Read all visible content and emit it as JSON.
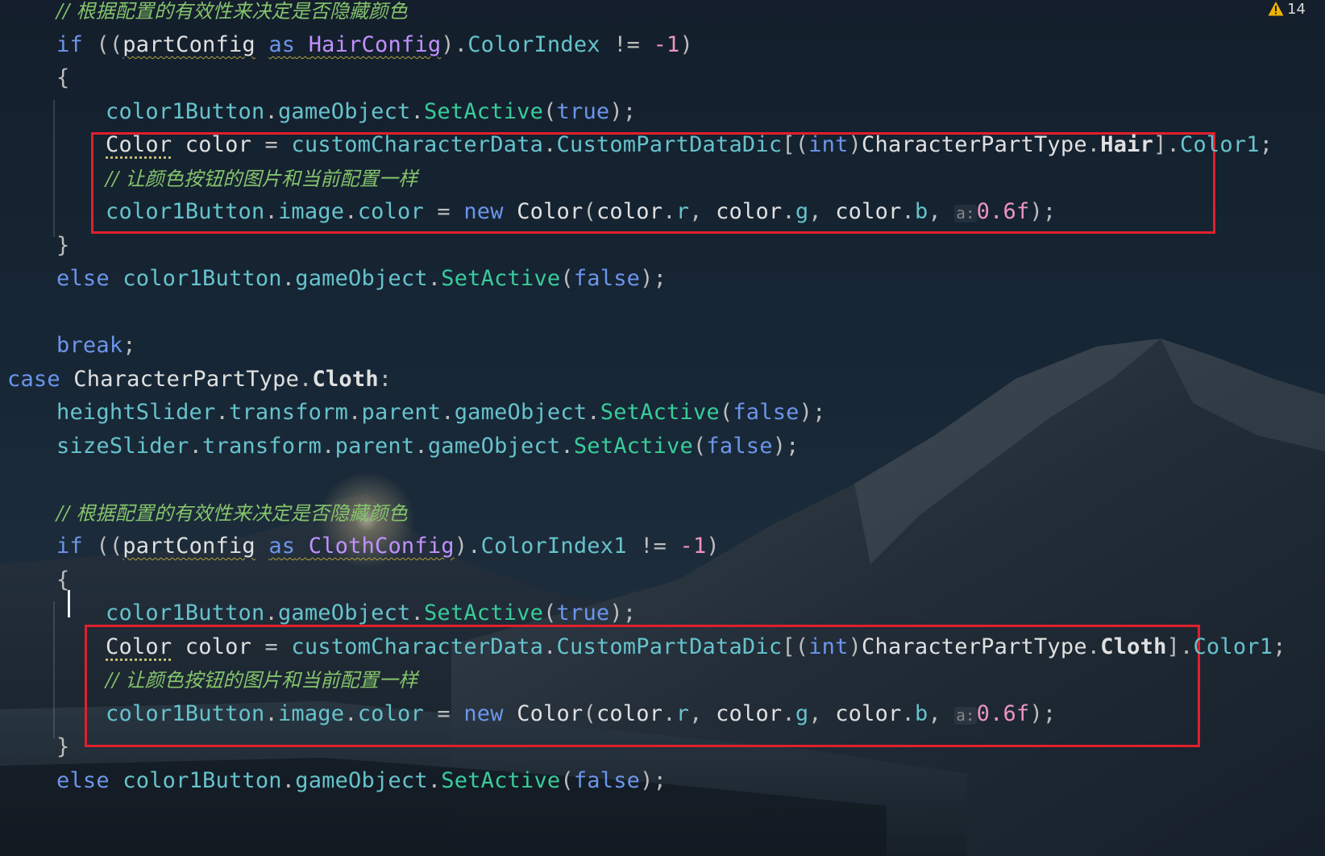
{
  "editor": {
    "problems": {
      "warning_count": "14",
      "icon": "warning-triangle-icon",
      "color": "#f0b400"
    },
    "colors": {
      "keyword": "#6c95eb",
      "field": "#66c3cc",
      "method": "#39cc9b",
      "class": "#c191ff",
      "number": "#ed94c0",
      "comment": "#85c46c",
      "highlight_box": "#e0202c"
    },
    "lines": [
      [
        {
          "t": "// 根据配置的有效性来决定是否隐藏颜色",
          "c": "cmt"
        }
      ],
      [
        {
          "t": "if",
          "c": "kw"
        },
        {
          "t": " ((",
          "c": "pun"
        },
        {
          "t": "partConfig",
          "c": "typ squig"
        },
        {
          "t": " ",
          "c": "pun"
        },
        {
          "t": "as",
          "c": "kw squig"
        },
        {
          "t": " ",
          "c": "pun squig"
        },
        {
          "t": "HairConfig",
          "c": "cls squig"
        },
        {
          "t": ").",
          "c": "pun"
        },
        {
          "t": "ColorIndex",
          "c": "id"
        },
        {
          "t": " != ",
          "c": "pun"
        },
        {
          "t": "-1",
          "c": "num"
        },
        {
          "t": ")",
          "c": "pun"
        }
      ],
      [
        {
          "t": "{",
          "c": "pun"
        }
      ],
      [
        {
          "t": "color1Button",
          "c": "id"
        },
        {
          "t": ".",
          "c": "pun"
        },
        {
          "t": "gameObject",
          "c": "id"
        },
        {
          "t": ".",
          "c": "pun"
        },
        {
          "t": "SetActive",
          "c": "meth"
        },
        {
          "t": "(",
          "c": "pun"
        },
        {
          "t": "true",
          "c": "kw"
        },
        {
          "t": ");",
          "c": "pun"
        }
      ],
      [
        {
          "t": "Color",
          "c": "typ dotted"
        },
        {
          "t": " ",
          "c": "pun"
        },
        {
          "t": "color",
          "c": "typ"
        },
        {
          "t": " = ",
          "c": "pun"
        },
        {
          "t": "customCharacterData",
          "c": "id"
        },
        {
          "t": ".",
          "c": "pun"
        },
        {
          "t": "CustomPartDataDic",
          "c": "id"
        },
        {
          "t": "[(",
          "c": "pun"
        },
        {
          "t": "int",
          "c": "kw"
        },
        {
          "t": ")",
          "c": "pun"
        },
        {
          "t": "CharacterPartType",
          "c": "typ"
        },
        {
          "t": ".",
          "c": "pun"
        },
        {
          "t": "Hair",
          "c": "enum"
        },
        {
          "t": "].",
          "c": "pun"
        },
        {
          "t": "Color1",
          "c": "id"
        },
        {
          "t": ";",
          "c": "pun"
        }
      ],
      [
        {
          "t": "// 让颜色按钮的图片和当前配置一样",
          "c": "cmt"
        }
      ],
      [
        {
          "t": "color1Button",
          "c": "id"
        },
        {
          "t": ".",
          "c": "pun"
        },
        {
          "t": "image",
          "c": "id"
        },
        {
          "t": ".",
          "c": "pun"
        },
        {
          "t": "color",
          "c": "id"
        },
        {
          "t": " = ",
          "c": "pun"
        },
        {
          "t": "new",
          "c": "kw"
        },
        {
          "t": " ",
          "c": "pun"
        },
        {
          "t": "Color",
          "c": "typ"
        },
        {
          "t": "(",
          "c": "pun"
        },
        {
          "t": "color",
          "c": "typ"
        },
        {
          "t": ".",
          "c": "pun"
        },
        {
          "t": "r",
          "c": "id"
        },
        {
          "t": ", ",
          "c": "pun"
        },
        {
          "t": "color",
          "c": "typ"
        },
        {
          "t": ".",
          "c": "pun"
        },
        {
          "t": "g",
          "c": "id"
        },
        {
          "t": ", ",
          "c": "pun"
        },
        {
          "t": "color",
          "c": "typ"
        },
        {
          "t": ".",
          "c": "pun"
        },
        {
          "t": "b",
          "c": "id"
        },
        {
          "t": ", ",
          "c": "pun"
        },
        {
          "t": "a:",
          "c": "hint"
        },
        {
          "t": "0.6f",
          "c": "num"
        },
        {
          "t": ");",
          "c": "pun"
        }
      ],
      [
        {
          "t": "}",
          "c": "pun"
        }
      ],
      [
        {
          "t": "else",
          "c": "kw"
        },
        {
          "t": " ",
          "c": "pun"
        },
        {
          "t": "color1Button",
          "c": "id"
        },
        {
          "t": ".",
          "c": "pun"
        },
        {
          "t": "gameObject",
          "c": "id"
        },
        {
          "t": ".",
          "c": "pun"
        },
        {
          "t": "SetActive",
          "c": "meth"
        },
        {
          "t": "(",
          "c": "pun"
        },
        {
          "t": "false",
          "c": "kw"
        },
        {
          "t": ");",
          "c": "pun"
        }
      ],
      [],
      [
        {
          "t": "break",
          "c": "kw"
        },
        {
          "t": ";",
          "c": "pun"
        }
      ],
      [
        {
          "t": "case",
          "c": "kw"
        },
        {
          "t": " ",
          "c": "pun"
        },
        {
          "t": "CharacterPartType",
          "c": "typ"
        },
        {
          "t": ".",
          "c": "pun"
        },
        {
          "t": "Cloth",
          "c": "enum"
        },
        {
          "t": ":",
          "c": "pun"
        }
      ],
      [
        {
          "t": "heightSlider",
          "c": "id"
        },
        {
          "t": ".",
          "c": "pun"
        },
        {
          "t": "transform",
          "c": "id"
        },
        {
          "t": ".",
          "c": "pun"
        },
        {
          "t": "parent",
          "c": "id"
        },
        {
          "t": ".",
          "c": "pun"
        },
        {
          "t": "gameObject",
          "c": "id"
        },
        {
          "t": ".",
          "c": "pun"
        },
        {
          "t": "SetActive",
          "c": "meth"
        },
        {
          "t": "(",
          "c": "pun"
        },
        {
          "t": "false",
          "c": "kw"
        },
        {
          "t": ");",
          "c": "pun"
        }
      ],
      [
        {
          "t": "sizeSlider",
          "c": "id"
        },
        {
          "t": ".",
          "c": "pun"
        },
        {
          "t": "transform",
          "c": "id"
        },
        {
          "t": ".",
          "c": "pun"
        },
        {
          "t": "parent",
          "c": "id"
        },
        {
          "t": ".",
          "c": "pun"
        },
        {
          "t": "gameObject",
          "c": "id"
        },
        {
          "t": ".",
          "c": "pun"
        },
        {
          "t": "SetActive",
          "c": "meth"
        },
        {
          "t": "(",
          "c": "pun"
        },
        {
          "t": "false",
          "c": "kw"
        },
        {
          "t": ");",
          "c": "pun"
        }
      ],
      [],
      [
        {
          "t": "// 根据配置的有效性来决定是否隐藏颜色",
          "c": "cmt"
        }
      ],
      [
        {
          "t": "if",
          "c": "kw"
        },
        {
          "t": " ((",
          "c": "pun"
        },
        {
          "t": "partConfig",
          "c": "typ squig"
        },
        {
          "t": " ",
          "c": "pun"
        },
        {
          "t": "as",
          "c": "kw squig"
        },
        {
          "t": " ",
          "c": "pun squig"
        },
        {
          "t": "ClothConfig",
          "c": "cls squig"
        },
        {
          "t": ").",
          "c": "pun"
        },
        {
          "t": "ColorIndex1",
          "c": "id"
        },
        {
          "t": " != ",
          "c": "pun"
        },
        {
          "t": "-1",
          "c": "num"
        },
        {
          "t": ")",
          "c": "pun"
        }
      ],
      [
        {
          "t": "{",
          "c": "pun"
        }
      ],
      [
        {
          "t": "color1Button",
          "c": "id"
        },
        {
          "t": ".",
          "c": "pun"
        },
        {
          "t": "gameObject",
          "c": "id"
        },
        {
          "t": ".",
          "c": "pun"
        },
        {
          "t": "SetActive",
          "c": "meth"
        },
        {
          "t": "(",
          "c": "pun"
        },
        {
          "t": "true",
          "c": "kw"
        },
        {
          "t": ");",
          "c": "pun"
        }
      ],
      [
        {
          "t": "Color",
          "c": "typ dotted"
        },
        {
          "t": " ",
          "c": "pun"
        },
        {
          "t": "color",
          "c": "typ"
        },
        {
          "t": " = ",
          "c": "pun"
        },
        {
          "t": "customCharacterData",
          "c": "id"
        },
        {
          "t": ".",
          "c": "pun"
        },
        {
          "t": "CustomPartDataDic",
          "c": "id"
        },
        {
          "t": "[(",
          "c": "pun"
        },
        {
          "t": "int",
          "c": "kw"
        },
        {
          "t": ")",
          "c": "pun"
        },
        {
          "t": "CharacterPartType",
          "c": "typ"
        },
        {
          "t": ".",
          "c": "pun"
        },
        {
          "t": "Cloth",
          "c": "enum"
        },
        {
          "t": "].",
          "c": "pun"
        },
        {
          "t": "Color1",
          "c": "id"
        },
        {
          "t": ";",
          "c": "pun"
        }
      ],
      [
        {
          "t": "// 让颜色按钮的图片和当前配置一样",
          "c": "cmt"
        }
      ],
      [
        {
          "t": "color1Button",
          "c": "id"
        },
        {
          "t": ".",
          "c": "pun"
        },
        {
          "t": "image",
          "c": "id"
        },
        {
          "t": ".",
          "c": "pun"
        },
        {
          "t": "color",
          "c": "id"
        },
        {
          "t": " = ",
          "c": "pun"
        },
        {
          "t": "new",
          "c": "kw"
        },
        {
          "t": " ",
          "c": "pun"
        },
        {
          "t": "Color",
          "c": "typ"
        },
        {
          "t": "(",
          "c": "pun"
        },
        {
          "t": "color",
          "c": "typ"
        },
        {
          "t": ".",
          "c": "pun"
        },
        {
          "t": "r",
          "c": "id"
        },
        {
          "t": ", ",
          "c": "pun"
        },
        {
          "t": "color",
          "c": "typ"
        },
        {
          "t": ".",
          "c": "pun"
        },
        {
          "t": "g",
          "c": "id"
        },
        {
          "t": ", ",
          "c": "pun"
        },
        {
          "t": "color",
          "c": "typ"
        },
        {
          "t": ".",
          "c": "pun"
        },
        {
          "t": "b",
          "c": "id"
        },
        {
          "t": ", ",
          "c": "pun"
        },
        {
          "t": "a:",
          "c": "hint"
        },
        {
          "t": "0.6f",
          "c": "num"
        },
        {
          "t": ");",
          "c": "pun"
        }
      ],
      [
        {
          "t": "}",
          "c": "pun"
        }
      ],
      [
        {
          "t": "else",
          "c": "kw"
        },
        {
          "t": " ",
          "c": "pun"
        },
        {
          "t": "color1Button",
          "c": "id"
        },
        {
          "t": ".",
          "c": "pun"
        },
        {
          "t": "gameObject",
          "c": "id"
        },
        {
          "t": ".",
          "c": "pun"
        },
        {
          "t": "SetActive",
          "c": "meth"
        },
        {
          "t": "(",
          "c": "pun"
        },
        {
          "t": "false",
          "c": "kw"
        },
        {
          "t": ");",
          "c": "pun"
        }
      ]
    ]
  }
}
